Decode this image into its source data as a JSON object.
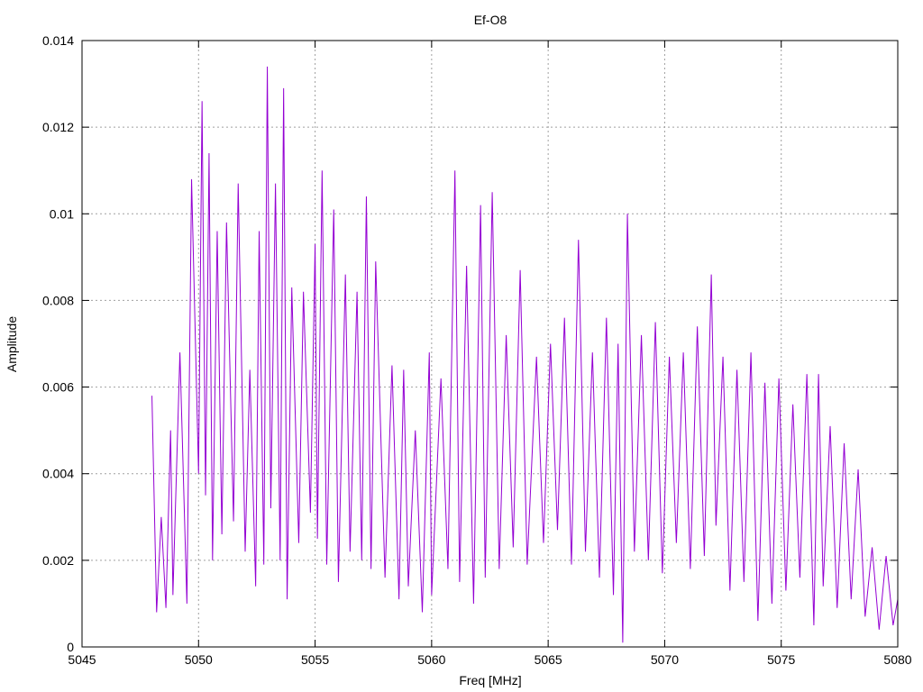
{
  "chart_data": {
    "type": "line",
    "title": "Ef-O8",
    "xlabel": "Freq [MHz]",
    "ylabel": "Amplitude",
    "xlim": [
      5045,
      5080
    ],
    "ylim": [
      0,
      0.014
    ],
    "grid": true,
    "legend": "none",
    "x_ticks": [
      5045,
      5050,
      5055,
      5060,
      5065,
      5070,
      5075,
      5080
    ],
    "x_tick_labels": [
      "5045",
      "5050",
      "5055",
      "5060",
      "5065",
      "5070",
      "5075",
      "5080"
    ],
    "y_ticks": [
      0,
      0.002,
      0.004,
      0.006,
      0.008,
      0.01,
      0.012,
      0.014
    ],
    "y_tick_labels": [
      "0",
      "0.002",
      "0.004",
      "0.006",
      "0.008",
      "0.01",
      "0.012",
      "0.014"
    ],
    "colors": {
      "series": "#9400d3",
      "grid": "#a0a0a0",
      "axis": "#000000"
    },
    "series": [
      {
        "x": [
          5048.0,
          5048.2,
          5048.4,
          5048.6,
          5048.8,
          5048.9,
          5049.2,
          5049.5,
          5049.7,
          5050.0,
          5050.15,
          5050.3,
          5050.45,
          5050.6,
          5050.8,
          5051.0,
          5051.2,
          5051.5,
          5051.7,
          5052.0,
          5052.2,
          5052.45,
          5052.6,
          5052.8,
          5052.95,
          5053.1,
          5053.3,
          5053.5,
          5053.65,
          5053.8,
          5054.0,
          5054.3,
          5054.5,
          5054.8,
          5055.0,
          5055.1,
          5055.3,
          5055.5,
          5055.8,
          5056.0,
          5056.3,
          5056.5,
          5056.8,
          5057.0,
          5057.2,
          5057.4,
          5057.6,
          5058.0,
          5058.3,
          5058.6,
          5058.8,
          5059.0,
          5059.3,
          5059.6,
          5059.9,
          5060.0,
          5060.4,
          5060.7,
          5061.0,
          5061.2,
          5061.5,
          5061.8,
          5062.1,
          5062.3,
          5062.6,
          5062.9,
          5063.2,
          5063.5,
          5063.8,
          5064.1,
          5064.5,
          5064.8,
          5065.1,
          5065.4,
          5065.7,
          5066.0,
          5066.3,
          5066.6,
          5066.9,
          5067.2,
          5067.5,
          5067.8,
          5068.0,
          5068.2,
          5068.4,
          5068.7,
          5069.0,
          5069.3,
          5069.6,
          5069.9,
          5070.2,
          5070.5,
          5070.8,
          5071.1,
          5071.4,
          5071.7,
          5072.0,
          5072.2,
          5072.5,
          5072.8,
          5073.1,
          5073.4,
          5073.7,
          5074.0,
          5074.3,
          5074.6,
          5074.9,
          5075.2,
          5075.5,
          5075.8,
          5076.1,
          5076.4,
          5076.6,
          5076.8,
          5077.1,
          5077.4,
          5077.7,
          5078.0,
          5078.3,
          5078.6,
          5078.9,
          5079.2,
          5079.5,
          5079.8,
          5080.0
        ],
        "y": [
          0.0058,
          0.0008,
          0.003,
          0.0009,
          0.005,
          0.0012,
          0.0068,
          0.001,
          0.0108,
          0.004,
          0.0126,
          0.0035,
          0.0114,
          0.002,
          0.0096,
          0.0026,
          0.0098,
          0.0029,
          0.0107,
          0.0022,
          0.0064,
          0.0014,
          0.0096,
          0.0019,
          0.0134,
          0.0032,
          0.0107,
          0.002,
          0.0129,
          0.0011,
          0.0083,
          0.0024,
          0.0082,
          0.0031,
          0.0093,
          0.0025,
          0.011,
          0.0019,
          0.0101,
          0.0015,
          0.0086,
          0.0022,
          0.0082,
          0.002,
          0.0104,
          0.0018,
          0.0089,
          0.0016,
          0.0065,
          0.0011,
          0.0064,
          0.0014,
          0.005,
          0.0008,
          0.0068,
          0.0012,
          0.0062,
          0.0018,
          0.011,
          0.0015,
          0.0088,
          0.001,
          0.0102,
          0.0016,
          0.0105,
          0.0018,
          0.0072,
          0.0023,
          0.0087,
          0.0019,
          0.0067,
          0.0024,
          0.007,
          0.0027,
          0.0076,
          0.0019,
          0.0094,
          0.0022,
          0.0068,
          0.0016,
          0.0076,
          0.0012,
          0.007,
          0.0001,
          0.01,
          0.0022,
          0.0072,
          0.002,
          0.0075,
          0.0017,
          0.0067,
          0.0024,
          0.0068,
          0.0018,
          0.0074,
          0.0021,
          0.0086,
          0.0028,
          0.0067,
          0.0013,
          0.0064,
          0.0015,
          0.0068,
          0.0006,
          0.0061,
          0.001,
          0.0062,
          0.0013,
          0.0056,
          0.0016,
          0.0063,
          0.0005,
          0.0063,
          0.0014,
          0.0051,
          0.0009,
          0.0047,
          0.0011,
          0.0041,
          0.0007,
          0.0023,
          0.0004,
          0.0021,
          0.0005,
          0.0011
        ]
      }
    ]
  }
}
